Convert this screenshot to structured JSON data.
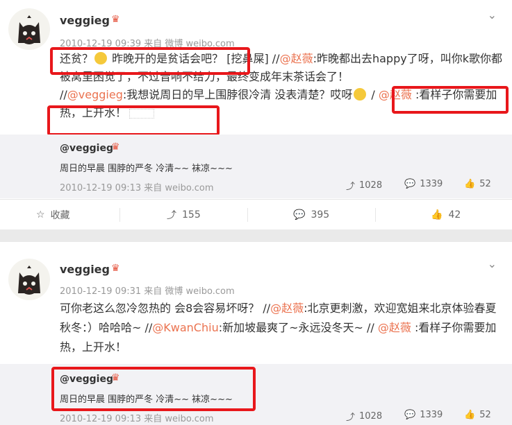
{
  "post1": {
    "username": "veggieg",
    "meta": "2010-12-19 09:39 来自 微博 weibo.com",
    "seg1": "还贫？",
    "seg2": " 昨晚开的是贫话会吧？",
    "seg3": "[挖鼻屎] //",
    "at1": "@赵薇",
    "seg4": ":昨晚都出去happy了呀，叫你k歌你都被窝里困觉了，不过音响不给力，最终变成年末茶话会了！",
    "seg5": "//",
    "at2": "@veggieg",
    "seg6": ":我想说周日的早上围脖很冷清 没表清楚？哎呀",
    "seg7": " / ",
    "at3": "@赵薇",
    "seg8": " :看样子你需要加热，上开水！",
    "quote_name": "@veggieg",
    "quote_text": "周日的早晨 围脖的严冬 冷清~~ 袜凉~~~",
    "quote_meta": "2010-12-19 09:13 来自 weibo.com",
    "q_repost": "1028",
    "q_comment": "1339",
    "q_like": "52",
    "fav_label": "收藏",
    "repost": "155",
    "comment": "395",
    "like": "42"
  },
  "post2": {
    "username": "veggieg",
    "meta": "2010-12-19 09:31 来自 微博 weibo.com",
    "seg1": "可你老这么忽冷忽热的 会8会容易坏呀？ //",
    "at1": "@赵薇",
    "seg2": ":北京更刺激，欢迎宽姐来北京体验春夏秋冬：）哈哈哈~ //",
    "at2": "@KwanChiu",
    "seg3": ":新加坡最爽了~永远没冬天~ // ",
    "at3": "@赵薇",
    "seg4": " :看样子你需要加热，上开水！",
    "quote_name": "@veggieg",
    "quote_text": "周日的早晨 围脖的严冬 冷清~~ 袜凉~~~",
    "quote_meta": "2010-12-19 09:13 来自 weibo.com",
    "q_repost": "1028",
    "q_comment": "1339",
    "q_like": "52"
  },
  "icons": [
    "cat-avatar",
    "vip-badge-icon",
    "chevron-down-icon",
    "star-icon",
    "repost-icon",
    "comment-icon",
    "thumbs-up-icon"
  ],
  "colors": {
    "mention": "#eb7350",
    "highlight": "#e8171b",
    "quote_bg": "#f2f2f5"
  }
}
